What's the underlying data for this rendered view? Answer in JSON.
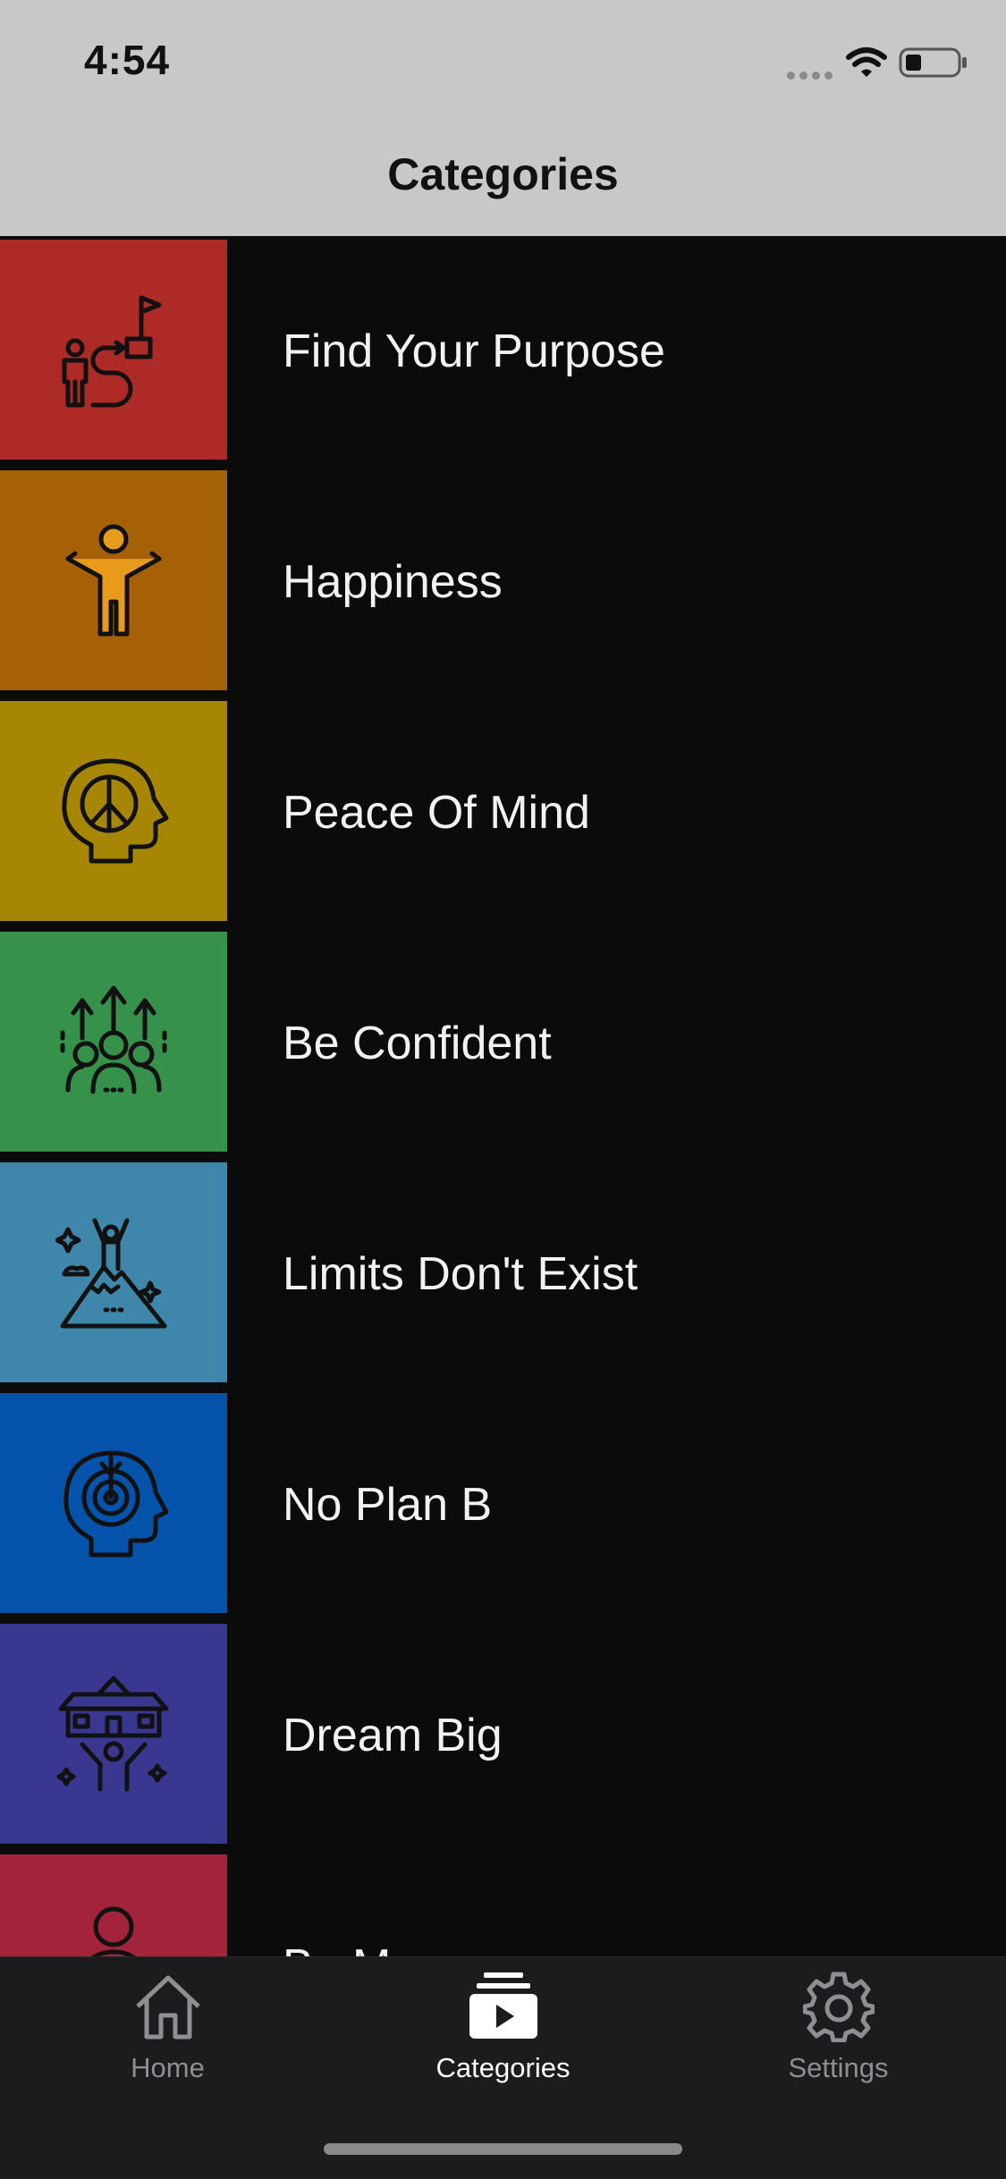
{
  "status_bar": {
    "time": "4:54",
    "icons": [
      "signal-dots-icon",
      "wifi-icon",
      "battery-icon"
    ]
  },
  "nav": {
    "title": "Categories"
  },
  "categories": [
    {
      "label": "Find Your Purpose",
      "color": "#ad2a27",
      "icon": "purpose-path-icon"
    },
    {
      "label": "Happiness",
      "color": "#a66005",
      "icon": "happy-person-icon"
    },
    {
      "label": "Peace Of Mind",
      "color": "#a78603",
      "icon": "peace-head-icon"
    },
    {
      "label": "Be Confident",
      "color": "#36914a",
      "icon": "confident-people-icon"
    },
    {
      "label": "Limits Don't Exist",
      "color": "#3f87aa",
      "icon": "mountain-summit-icon"
    },
    {
      "label": "No Plan B",
      "color": "#0453ab",
      "icon": "target-head-icon"
    },
    {
      "label": "Dream Big",
      "color": "#3a3790",
      "icon": "dream-house-icon"
    },
    {
      "label": "Be M",
      "color": "#a3223c",
      "icon": "person-icon"
    }
  ],
  "tabs": [
    {
      "label": "Home",
      "icon": "home-icon",
      "active": false
    },
    {
      "label": "Categories",
      "icon": "categories-play-icon",
      "active": true
    },
    {
      "label": "Settings",
      "icon": "gear-icon",
      "active": false
    }
  ]
}
